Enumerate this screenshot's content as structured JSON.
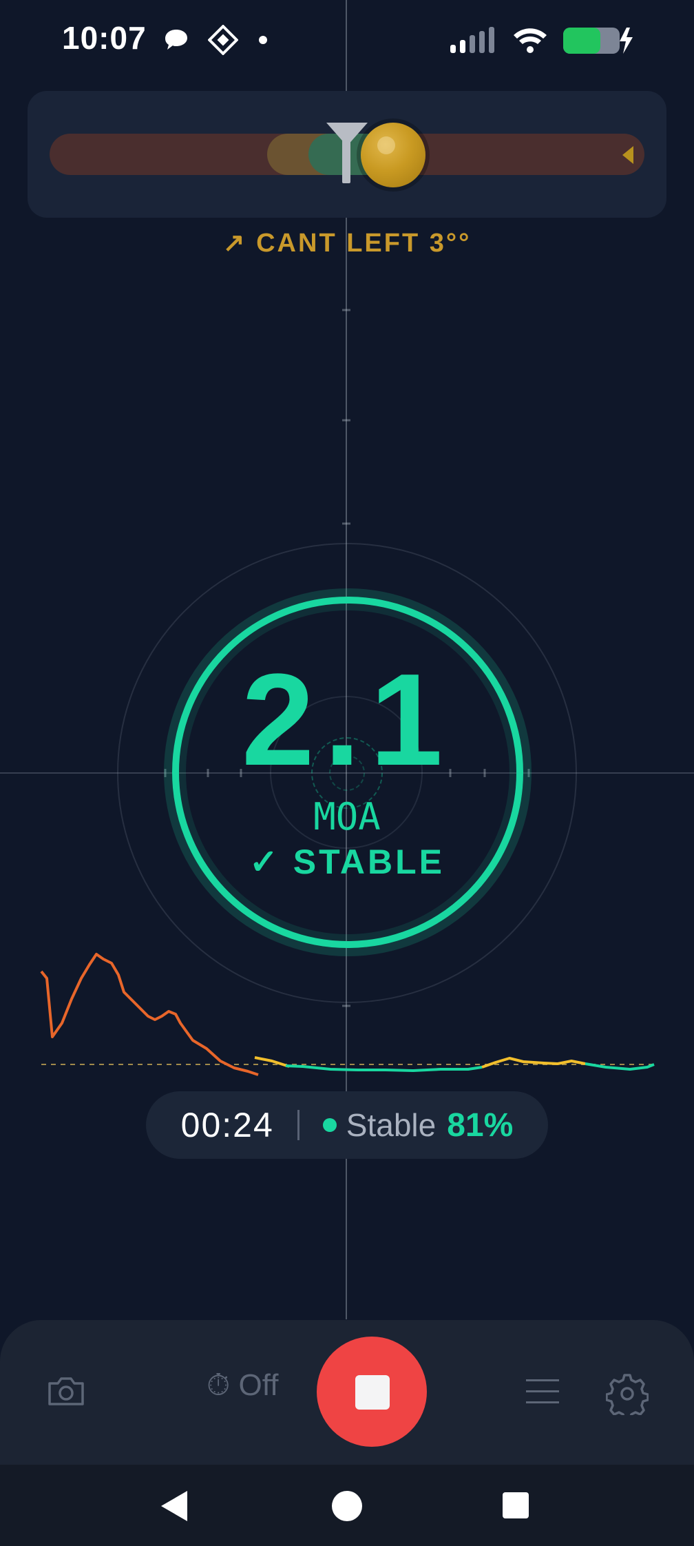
{
  "status_bar": {
    "time": "10:07",
    "icons": [
      "chat-bubble-icon",
      "signal-app-icon",
      "notification-dot-icon",
      "cell-signal-icon",
      "wifi-icon",
      "battery-charging-icon"
    ],
    "battery_color": "#22c55e"
  },
  "cant": {
    "label": "↗ CANT LEFT 3°°"
  },
  "reading": {
    "value": "2.1",
    "unit": "MOA",
    "status": "✓ STABLE",
    "accent": "#19d7a0"
  },
  "stability_trace": {
    "colors": {
      "unstable": "#e8662a",
      "warning": "#f2bf2c",
      "stable": "#19d7a0"
    }
  },
  "session": {
    "elapsed": "00:24",
    "stable_label": "Stable",
    "stable_percent": "81%"
  },
  "toolbar": {
    "timer_label": "⏱ Off",
    "record_color": "#ef4444"
  }
}
